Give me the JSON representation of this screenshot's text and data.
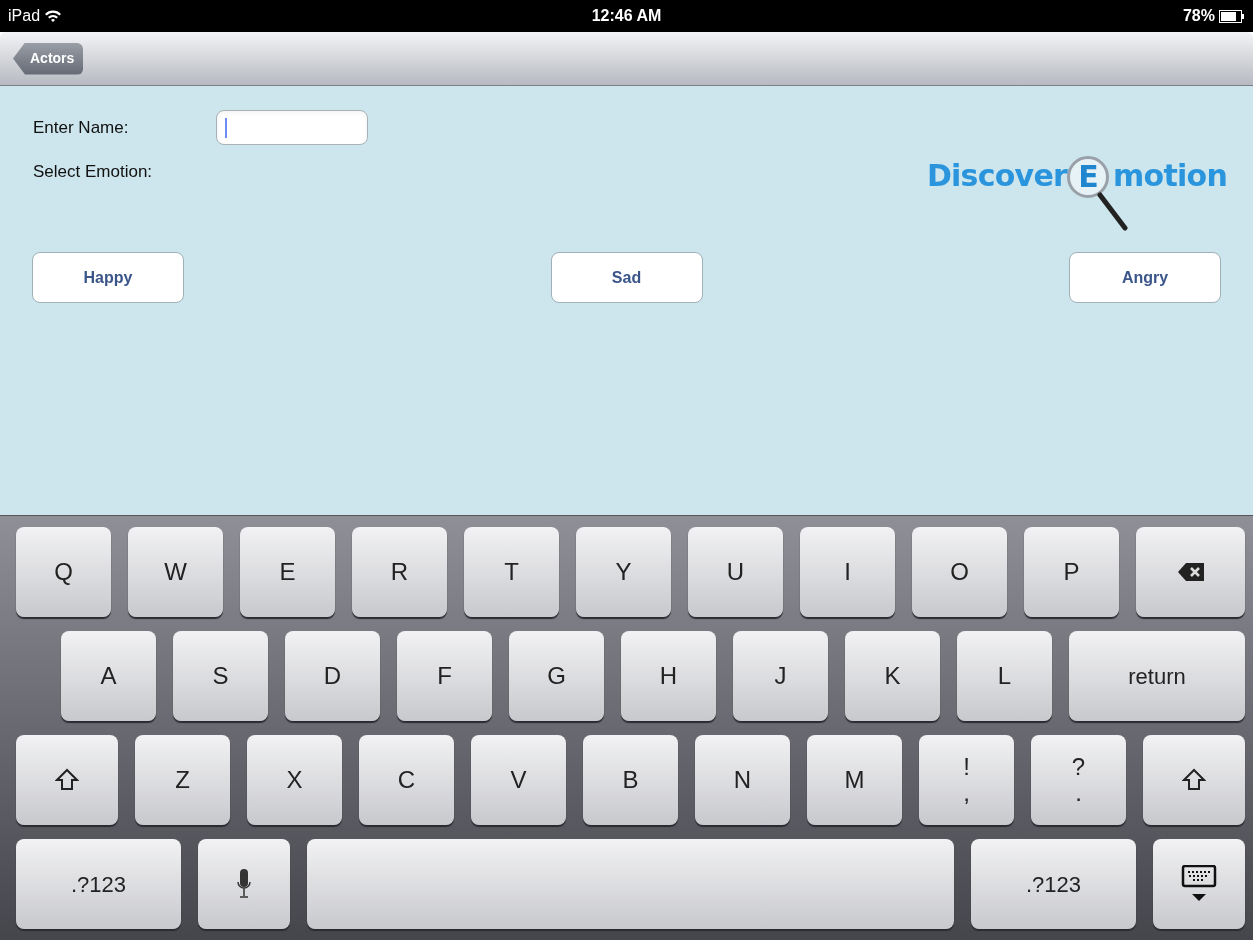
{
  "status_bar": {
    "device": "iPad",
    "time": "12:46 AM",
    "battery": "78%"
  },
  "nav_bar": {
    "back_button": "Actors"
  },
  "form": {
    "name_label": "Enter Name:",
    "emotion_label": "Select Emotion:"
  },
  "logo": {
    "before": "Discover",
    "lens_letter": "E",
    "after": "motion"
  },
  "emotion_buttons": [
    "Happy",
    "Sad",
    "Angry"
  ],
  "keyboard": {
    "key_rows": [
      {
        "keys": [
          {
            "kind": "letter",
            "label": "Q"
          },
          {
            "kind": "letter",
            "label": "W"
          },
          {
            "kind": "letter",
            "label": "E"
          },
          {
            "kind": "letter",
            "label": "R"
          },
          {
            "kind": "letter",
            "label": "T"
          },
          {
            "kind": "letter",
            "label": "Y"
          },
          {
            "kind": "letter",
            "label": "U"
          },
          {
            "kind": "letter",
            "label": "I"
          },
          {
            "kind": "letter",
            "label": "O"
          },
          {
            "kind": "letter",
            "label": "P"
          },
          {
            "kind": "backspace"
          }
        ]
      },
      {
        "keys": [
          {
            "kind": "letter",
            "label": "A"
          },
          {
            "kind": "letter",
            "label": "S"
          },
          {
            "kind": "letter",
            "label": "D"
          },
          {
            "kind": "letter",
            "label": "F"
          },
          {
            "kind": "letter",
            "label": "G"
          },
          {
            "kind": "letter",
            "label": "H"
          },
          {
            "kind": "letter",
            "label": "J"
          },
          {
            "kind": "letter",
            "label": "K"
          },
          {
            "kind": "letter",
            "label": "L"
          },
          {
            "kind": "wide",
            "label": "return"
          }
        ]
      },
      {
        "keys": [
          {
            "kind": "shift"
          },
          {
            "kind": "letter",
            "label": "Z"
          },
          {
            "kind": "letter",
            "label": "X"
          },
          {
            "kind": "letter",
            "label": "C"
          },
          {
            "kind": "letter",
            "label": "V"
          },
          {
            "kind": "letter",
            "label": "B"
          },
          {
            "kind": "letter",
            "label": "N"
          },
          {
            "kind": "letter",
            "label": "M"
          },
          {
            "kind": "punct",
            "upper": "!",
            "lower": ","
          },
          {
            "kind": "punct",
            "upper": "?",
            "lower": "."
          },
          {
            "kind": "shift"
          }
        ]
      },
      {
        "keys": [
          {
            "kind": "numbers",
            "label": ".?123"
          },
          {
            "kind": "mic"
          },
          {
            "kind": "space"
          },
          {
            "kind": "numbers",
            "label": ".?123"
          },
          {
            "kind": "dismiss"
          }
        ]
      }
    ]
  }
}
